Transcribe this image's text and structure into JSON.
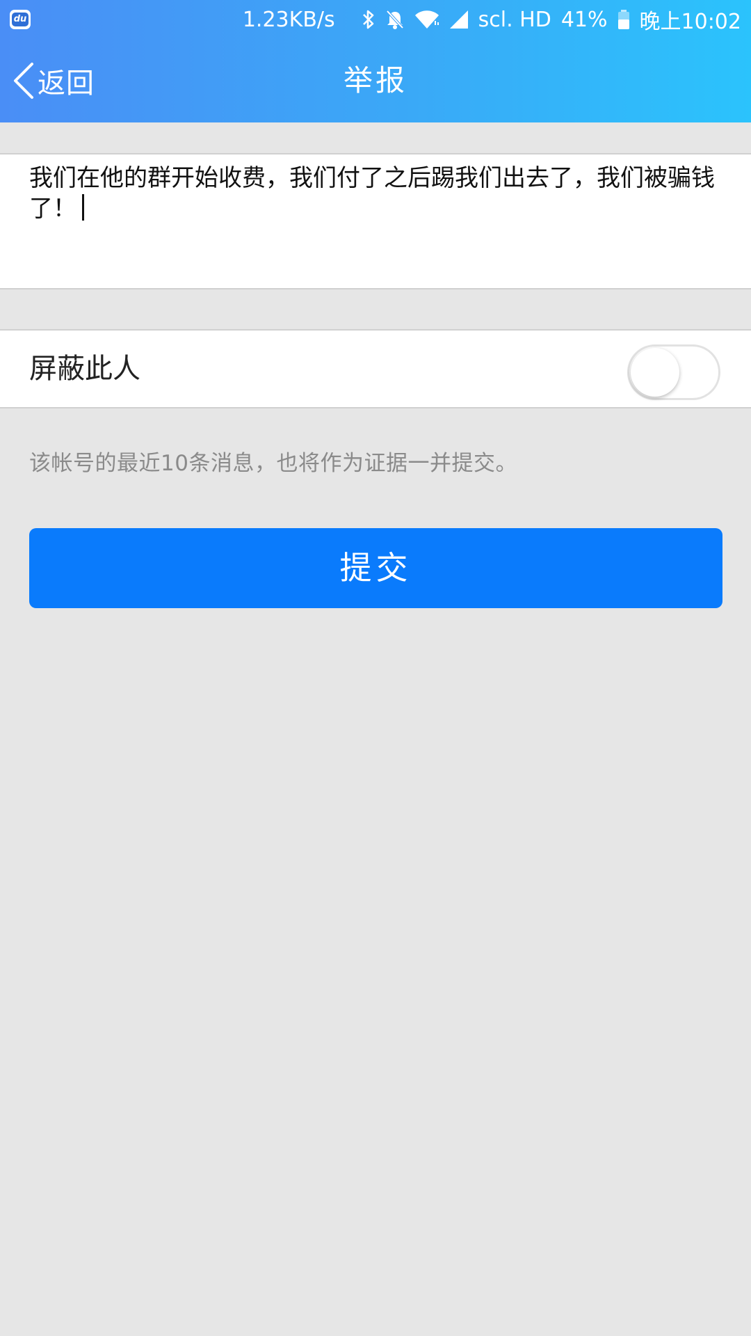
{
  "status_bar": {
    "app_icon_text": "du",
    "net_speed": "1.23KB/s",
    "carrier": "scl. HD",
    "battery": "41%",
    "time": "晚上10:02",
    "icons": [
      "bluetooth-icon",
      "bell-off-icon",
      "wifi-icon",
      "cell-signal-icon",
      "battery-icon"
    ]
  },
  "nav": {
    "back_label": "返回",
    "title": "举报"
  },
  "report": {
    "text": "我们在他的群开始收费，我们付了之后踢我们出去了，我们被骗钱了！"
  },
  "block_user": {
    "label": "屏蔽此人",
    "enabled": false
  },
  "hint": "该帐号的最近10条消息，也将作为证据一并提交。",
  "submit_label": "提交",
  "colors": {
    "header_gradient_start": "#4a8ef6",
    "header_gradient_end": "#2bc3fc",
    "submit_button": "#0a7bfc",
    "background": "#e6e6e6"
  }
}
